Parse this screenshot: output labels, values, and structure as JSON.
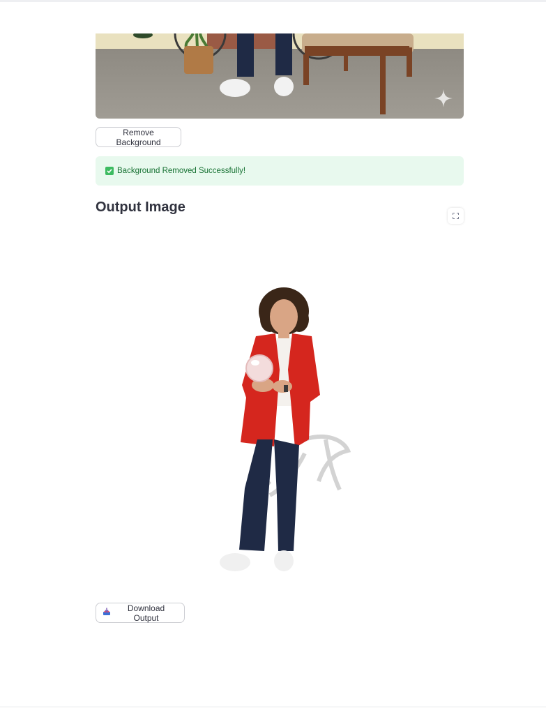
{
  "input_section": {
    "image_alt": "Input image: woman standing in a room with a bicycle, plant and armchair",
    "watermark_icon": "sparkle-icon"
  },
  "remove_button": {
    "label": "Remove Background"
  },
  "alert": {
    "icon": "check-box-icon",
    "message": "Background Removed Successfully!"
  },
  "output_section": {
    "title": "Output Image",
    "fullscreen_icon": "fullscreen-icon",
    "image_alt": "Output image: woman in red blazer with background removed"
  },
  "download_button": {
    "icon": "inbox-tray-icon",
    "label": "Download Output"
  },
  "colors": {
    "success_bg": "#e8f9ee",
    "success_text": "#177233",
    "blazer": "#d5261e"
  }
}
